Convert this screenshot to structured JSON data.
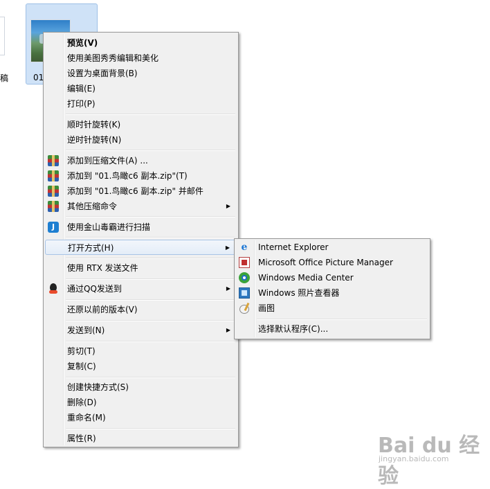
{
  "desktop": {
    "left_file_label": "稿",
    "selected_file_label": "01"
  },
  "context_menu": {
    "items": [
      {
        "label": "预览(V)",
        "bold": true
      },
      {
        "label": "使用美图秀秀编辑和美化"
      },
      {
        "label": "设置为桌面背景(B)"
      },
      {
        "label": "编辑(E)"
      },
      {
        "label": "打印(P)"
      },
      {
        "label": "顺时针旋转(K)"
      },
      {
        "label": "逆时针旋转(N)"
      },
      {
        "label": "添加到压缩文件(A) ...",
        "icon": "winrar-icon"
      },
      {
        "label": "添加到 \"01.鸟瞰c6 副本.zip\"(T)",
        "icon": "winrar-icon"
      },
      {
        "label": "添加到 \"01.鸟瞰c6 副本.zip\" 并邮件",
        "icon": "winrar-icon"
      },
      {
        "label": "其他压缩命令",
        "icon": "winrar-icon"
      },
      {
        "label": "使用金山毒霸进行扫描",
        "icon": "kingsoft-antivirus-icon"
      },
      {
        "label": "打开方式(H)"
      },
      {
        "label": "使用 RTX 发送文件"
      },
      {
        "label": "通过QQ发送到",
        "icon": "qq-icon"
      },
      {
        "label": "还原以前的版本(V)"
      },
      {
        "label": "发送到(N)"
      },
      {
        "label": "剪切(T)"
      },
      {
        "label": "复制(C)"
      },
      {
        "label": "创建快捷方式(S)"
      },
      {
        "label": "删除(D)"
      },
      {
        "label": "重命名(M)"
      },
      {
        "label": "属性(R)"
      }
    ],
    "submenu_arrow": "▶"
  },
  "open_with_submenu": {
    "items": [
      {
        "label": "Internet Explorer",
        "icon": "internet-explorer-icon"
      },
      {
        "label": "Microsoft Office Picture Manager",
        "icon": "picture-manager-icon"
      },
      {
        "label": "Windows Media Center",
        "icon": "media-center-icon"
      },
      {
        "label": "Windows 照片查看器",
        "icon": "photo-viewer-icon"
      },
      {
        "label": "画图",
        "icon": "paint-icon"
      },
      {
        "label": "选择默认程序(C)..."
      }
    ]
  },
  "watermark": {
    "brand": "Bai du 经验",
    "url": "jingyan.baidu.com"
  }
}
